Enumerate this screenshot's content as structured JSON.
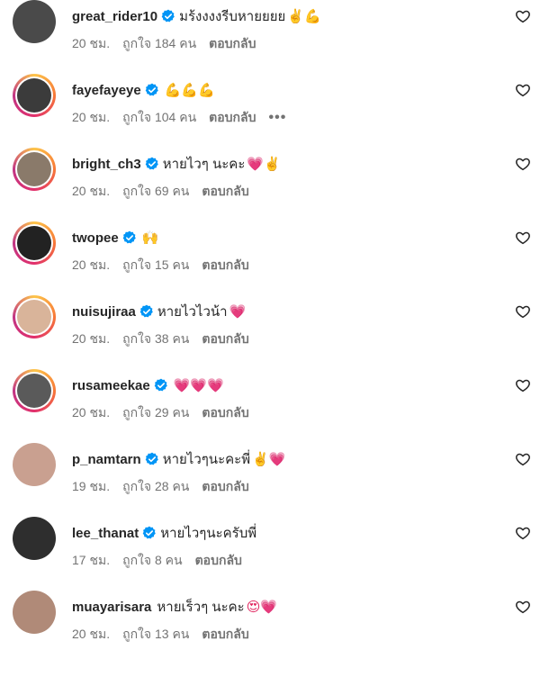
{
  "colors": {
    "verified": "#0095f6",
    "meta_text": "#737373",
    "text": "#262626",
    "heart_emoji": "#e0245e"
  },
  "comments": [
    {
      "username": "great_rider10",
      "verified": true,
      "text": "มร้งงงงรีบหายยยย",
      "emoji": "✌️💪",
      "time": "20 ชม.",
      "likes": "ถูกใจ 184 คน",
      "reply": "ตอบกลับ",
      "more": "",
      "avatar_ring": "plain",
      "avatar_color": "#4a4a4a"
    },
    {
      "username": "fayefayeye",
      "verified": true,
      "text": "",
      "emoji": "💪💪💪",
      "time": "20 ชม.",
      "likes": "ถูกใจ 104 คน",
      "reply": "ตอบกลับ",
      "more": "•••",
      "avatar_ring": "story",
      "avatar_color": "#3b3b3b"
    },
    {
      "username": "bright_ch3",
      "verified": true,
      "text": "หายไวๆ นะคะ",
      "emoji": "💗✌️",
      "time": "20 ชม.",
      "likes": "ถูกใจ 69 คน",
      "reply": "ตอบกลับ",
      "more": "",
      "avatar_ring": "story",
      "avatar_color": "#8a7a6a"
    },
    {
      "username": "twopee",
      "verified": true,
      "text": "",
      "emoji": "🙌",
      "time": "20 ชม.",
      "likes": "ถูกใจ 15 คน",
      "reply": "ตอบกลับ",
      "more": "",
      "avatar_ring": "story",
      "avatar_color": "#222222"
    },
    {
      "username": "nuisujiraa",
      "verified": true,
      "text": "หายไวไวน้า",
      "emoji": "💗",
      "time": "20 ชม.",
      "likes": "ถูกใจ 38 คน",
      "reply": "ตอบกลับ",
      "more": "",
      "avatar_ring": "story",
      "avatar_color": "#d9b49a"
    },
    {
      "username": "rusameekae",
      "verified": true,
      "text": "",
      "emoji": "💗💗💗",
      "time": "20 ชม.",
      "likes": "ถูกใจ 29 คน",
      "reply": "ตอบกลับ",
      "more": "",
      "avatar_ring": "story",
      "avatar_color": "#5a5a5a"
    },
    {
      "username": "p_namtarn",
      "verified": true,
      "text": "หายไวๆนะคะพี่",
      "emoji": "✌️💗",
      "time": "19 ชม.",
      "likes": "ถูกใจ 28 คน",
      "reply": "ตอบกลับ",
      "more": "",
      "avatar_ring": "plain",
      "avatar_color": "#c9a090"
    },
    {
      "username": "lee_thanat",
      "verified": true,
      "text": "หายไวๆนะครับพี่",
      "emoji": "",
      "time": "17 ชม.",
      "likes": "ถูกใจ 8 คน",
      "reply": "ตอบกลับ",
      "more": "",
      "avatar_ring": "plain",
      "avatar_color": "#2e2e2e"
    },
    {
      "username": "muayarisara",
      "verified": false,
      "text": "หายเร็วๆ นะคะ",
      "emoji": "😍💗",
      "time": "20 ชม.",
      "likes": "ถูกใจ 13 คน",
      "reply": "ตอบกลับ",
      "more": "",
      "avatar_ring": "plain",
      "avatar_color": "#b08a78"
    }
  ]
}
